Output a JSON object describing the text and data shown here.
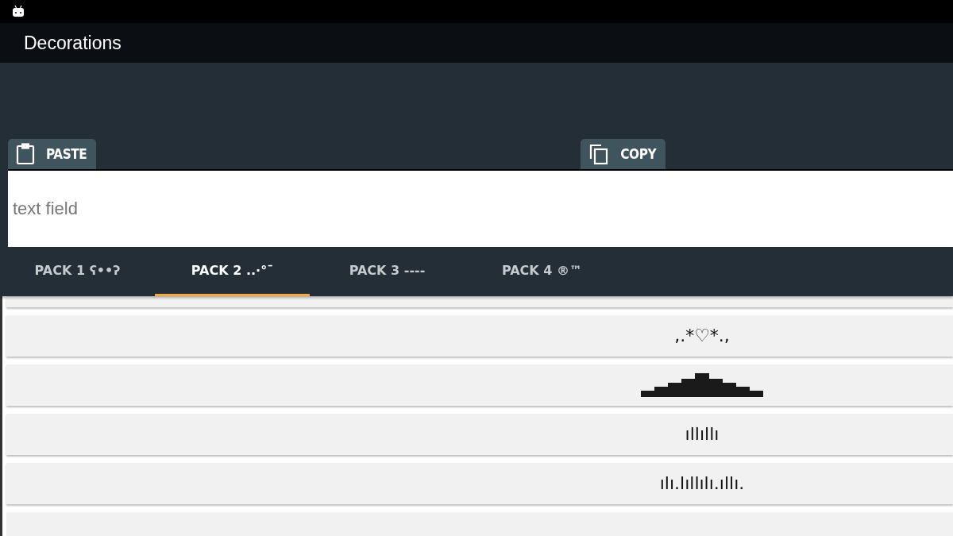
{
  "app_bar": {
    "title": "Decorations"
  },
  "actions": [
    {
      "kind": "paste",
      "label": "PASTE"
    },
    {
      "kind": "copy",
      "label": "COPY"
    }
  ],
  "text_field": {
    "placeholder": "text field"
  },
  "tabs": [
    {
      "label": "PACK 1 ʕ••ʔ",
      "selected": false
    },
    {
      "label": "PACK 2 ..·°¯",
      "selected": true
    },
    {
      "label": "PACK 3 ----",
      "selected": false
    },
    {
      "label": "PACK 4 ®™",
      "selected": false
    }
  ],
  "rows": [
    {
      "kind": "text",
      "text": ",.*♡*.,"
    },
    {
      "kind": "pyramid"
    },
    {
      "kind": "text",
      "text": "ıllıllı"
    },
    {
      "kind": "text",
      "text": "ılı.lıllılı.ıllı."
    }
  ]
}
